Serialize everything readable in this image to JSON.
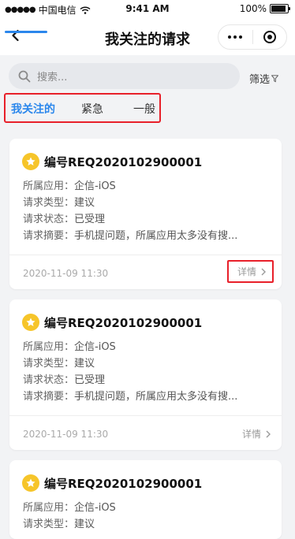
{
  "status_bar": {
    "carrier": "中国电信",
    "time": "9:41 AM",
    "battery": "100%",
    "battery_level": 1.0
  },
  "nav": {
    "title": "我关注的请求"
  },
  "search": {
    "placeholder": "搜索...",
    "filter_label": "筛选"
  },
  "tabs": [
    {
      "label": "我关注的",
      "active": true
    },
    {
      "label": "紧急",
      "active": false
    },
    {
      "label": "一般",
      "active": false
    }
  ],
  "labels": {
    "app": "所属应用：",
    "type": "请求类型：",
    "status": "请求状态：",
    "summary": "请求摘要：",
    "detail": "详情"
  },
  "cards": [
    {
      "id": "编号REQ2020102900001",
      "app": "企信-iOS",
      "type": "建议",
      "status": "已受理",
      "summary": "手机提问题，所属应用太多没有搜...",
      "time": "2020-11-09  11:30"
    },
    {
      "id": "编号REQ2020102900001",
      "app": "企信-iOS",
      "type": "建议",
      "status": "已受理",
      "summary": "手机提问题，所属应用太多没有搜...",
      "time": "2020-11-09 11:30"
    },
    {
      "id": "编号REQ2020102900001",
      "app": "企信-iOS",
      "type": "建议"
    }
  ],
  "colors": {
    "accent": "#2b87ec",
    "highlight_box": "#e8202a",
    "star": "#f6c52a",
    "background": "#f2f3f5"
  }
}
